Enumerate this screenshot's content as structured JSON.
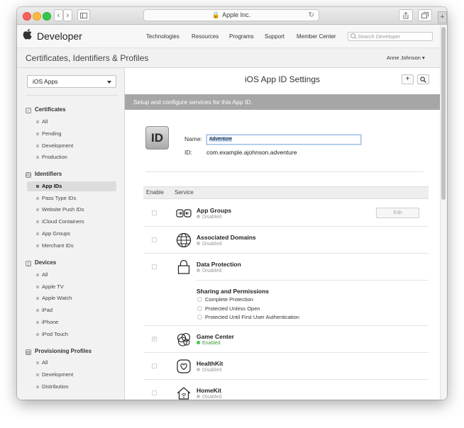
{
  "browser": {
    "url": "Apple Inc.",
    "new_tab": "+"
  },
  "header": {
    "brand": "Developer",
    "nav": [
      "Technologies",
      "Resources",
      "Programs",
      "Support",
      "Member Center"
    ],
    "search_placeholder": "Search Developer"
  },
  "section": {
    "title": "Certificates, Identifiers & Profiles",
    "user": "Anne Johnson ▾"
  },
  "sidebar": {
    "dropdown": "iOS Apps",
    "groups": [
      {
        "label": "Certificates",
        "icon": "certificate-icon",
        "items": [
          "All",
          "Pending",
          "Development",
          "Production"
        ]
      },
      {
        "label": "Identifiers",
        "icon": "id-icon",
        "items": [
          "App IDs",
          "Pass Type IDs",
          "Website Push IDs",
          "iCloud Containers",
          "App Groups",
          "Merchant IDs"
        ]
      },
      {
        "label": "Devices",
        "icon": "device-icon",
        "items": [
          "All",
          "Apple TV",
          "Apple Watch",
          "iPad",
          "iPhone",
          "iPod Touch"
        ]
      },
      {
        "label": "Provisioning Profiles",
        "icon": "profile-icon",
        "items": [
          "All",
          "Development",
          "Distribution"
        ]
      }
    ],
    "selected": "App IDs"
  },
  "main": {
    "title": "iOS App ID Settings",
    "add_button": "+",
    "subtitle": "Setup and configure services for this App ID.",
    "app_icon_text": "ID",
    "name_label": "Name:",
    "name_value": "Adventure",
    "id_label": "ID:",
    "id_value": "com.example.ajohnson.adventure",
    "columns": {
      "enable": "Enable",
      "service": "Service"
    },
    "services": [
      {
        "name": "App Groups",
        "status": "Disabled",
        "enabled": false,
        "icon": "app-groups-icon",
        "edit": "Edit"
      },
      {
        "name": "Associated Domains",
        "status": "Disabled",
        "enabled": false,
        "icon": "globe-icon"
      },
      {
        "name": "Data Protection",
        "status": "Disabled",
        "enabled": false,
        "icon": "lock-icon"
      },
      {
        "name": "Game Center",
        "status": "Enabled",
        "enabled": true,
        "icon": "game-center-icon"
      },
      {
        "name": "HealthKit",
        "status": "Disabled",
        "enabled": false,
        "icon": "healthkit-icon"
      },
      {
        "name": "HomeKit",
        "status": "Disabled",
        "enabled": false,
        "icon": "homekit-icon"
      }
    ],
    "sharing": {
      "title": "Sharing and Permissions",
      "options": [
        "Complete Protection",
        "Protected Unless Open",
        "Protected Until First User Authentication"
      ]
    }
  }
}
